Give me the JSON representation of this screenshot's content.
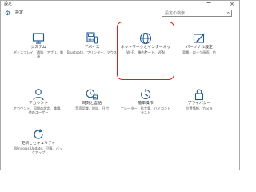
{
  "window": {
    "title": "設定",
    "min_label": "−",
    "max_label": "□",
    "close_label": "×"
  },
  "header": {
    "title": "設定",
    "search_placeholder": "設定の検索",
    "search_icon": "magnifier-icon",
    "gear_icon": "gear-icon"
  },
  "tiles": [
    {
      "label": "システム",
      "desc": "ディスプレイ、通知、アプリ、電源",
      "icon": "monitor-icon"
    },
    {
      "label": "デバイス",
      "desc": "Bluetooth、プリンター、マウス",
      "icon": "keyboard-icon"
    },
    {
      "label": "ネットワークとインターネット",
      "desc": "Wi-Fi、機内モード、VPN",
      "icon": "globe-icon"
    },
    {
      "label": "パーソナル設定",
      "desc": "背景、ロック画面、色",
      "icon": "paint-icon"
    },
    {
      "label": "アカウント",
      "desc": "アカウント、同期の設定、職場、他のユーザー",
      "icon": "person-icon"
    },
    {
      "label": "時刻と言語",
      "desc": "音声認識、地域、日付",
      "icon": "clock-language-icon"
    },
    {
      "label": "簡単操作",
      "desc": "ナレーター、拡大鏡、ハイコントラスト",
      "icon": "ease-of-access-icon"
    },
    {
      "label": "プライバシー",
      "desc": "位置情報、カメラ",
      "icon": "lock-icon"
    },
    {
      "label": "更新とセキュリティ",
      "desc": "Windows Update、回復、バックアップ",
      "icon": "update-icon"
    }
  ],
  "colors": {
    "accent": "#1f5a92",
    "highlight": "#e6191e"
  }
}
